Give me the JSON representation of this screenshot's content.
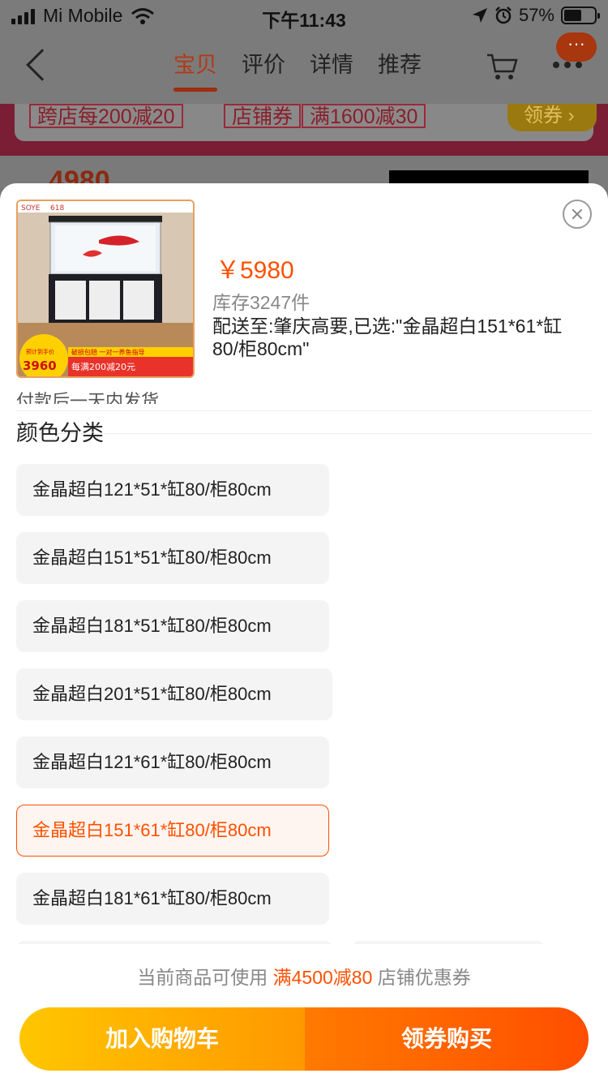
{
  "status_bar": {
    "carrier": "Mi Mobile",
    "time": "下午11:43",
    "battery": "57%"
  },
  "nav": {
    "tabs": [
      {
        "label": "宝贝",
        "active": true
      },
      {
        "label": "评价",
        "active": false
      },
      {
        "label": "详情",
        "active": false
      },
      {
        "label": "推荐",
        "active": false
      }
    ],
    "more_bubble": "···"
  },
  "background": {
    "coupon_1": "跨店每200减20",
    "coupon_2_a": "店铺券",
    "coupon_2_b": "满1600减30",
    "claim": "领券",
    "price_partial": "4980"
  },
  "product": {
    "thumbnail": {
      "brand": "SOYE",
      "badge_price": "3960",
      "badge_label": "预计到手价",
      "banner_top": "破损包赔 一对一养鱼指导",
      "banner_bottom": "每满200减20元",
      "tag": "618"
    },
    "price": "￥5980",
    "stock": "库存3247件",
    "selected": "配送至:肇庆高要,已选:\"金晶超白151*61*缸80/柜80cm\""
  },
  "color_section": {
    "cut_text": "付款后一天内发货",
    "title": "颜色分类",
    "options": [
      {
        "label": "金晶超白121*51*缸80/柜80cm",
        "selected": false
      },
      {
        "label": "金晶超白151*51*缸80/柜80cm",
        "selected": false
      },
      {
        "label": "金晶超白181*51*缸80/柜80cm",
        "selected": false
      },
      {
        "label": "金晶超白201*51*缸80/柜80cm",
        "selected": false
      },
      {
        "label": "金晶超白121*61*缸80/柜80cm",
        "selected": false
      },
      {
        "label": "金晶超白151*61*缸80/柜80cm",
        "selected": true
      },
      {
        "label": "金晶超白181*61*缸80/柜80cm",
        "selected": false
      },
      {
        "label": "",
        "selected": false
      },
      {
        "label": "",
        "selected": false
      }
    ]
  },
  "coupon_line": {
    "prefix": "当前商品可使用",
    "highlight": "满4500减80",
    "suffix": "店铺优惠券"
  },
  "buttons": {
    "add_to_cart": "加入购物车",
    "buy": "领券购买"
  },
  "colors": {
    "accent": "#ff5000",
    "cart_button": "#ffb000",
    "buy_button": "#ff5a00"
  }
}
